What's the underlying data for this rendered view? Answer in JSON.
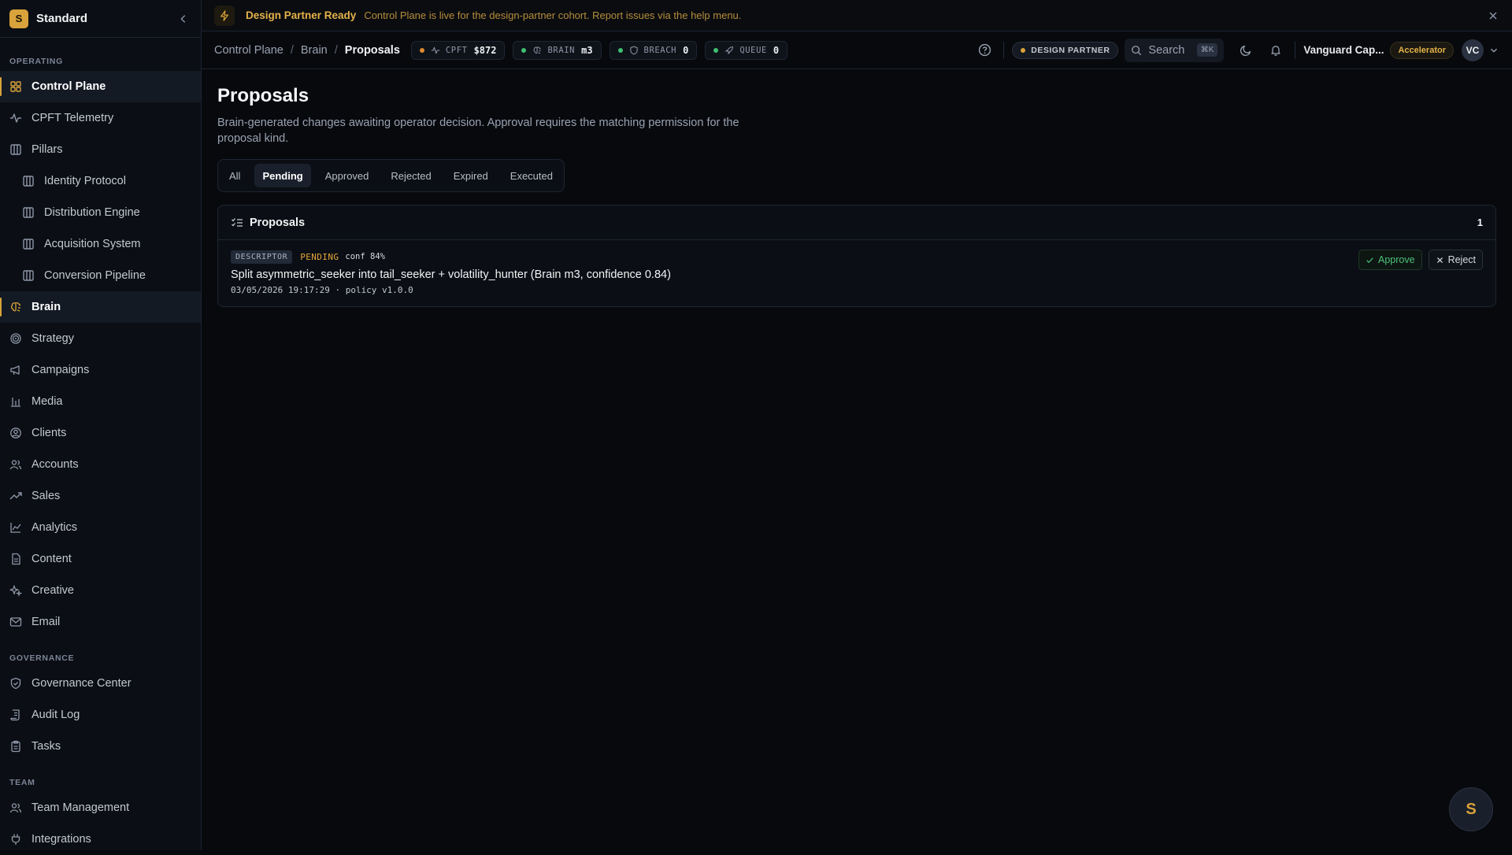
{
  "brand": {
    "logo": "S",
    "name": "Standard"
  },
  "sidebar": {
    "sections": [
      {
        "label": "OPERATING",
        "items": [
          {
            "label": "Control Plane",
            "icon": "grid-icon",
            "active": true
          },
          {
            "label": "CPFT Telemetry",
            "icon": "activity-icon"
          },
          {
            "label": "Pillars",
            "icon": "columns-icon"
          },
          {
            "label": "Identity Protocol",
            "icon": "columns-icon",
            "sub": true
          },
          {
            "label": "Distribution Engine",
            "icon": "columns-icon",
            "sub": true
          },
          {
            "label": "Acquisition System",
            "icon": "columns-icon",
            "sub": true
          },
          {
            "label": "Conversion Pipeline",
            "icon": "columns-icon",
            "sub": true
          },
          {
            "label": "Brain",
            "icon": "brain-icon",
            "active": true
          },
          {
            "label": "Strategy",
            "icon": "target-icon"
          },
          {
            "label": "Campaigns",
            "icon": "megaphone-icon"
          },
          {
            "label": "Media",
            "icon": "bar-chart-icon"
          },
          {
            "label": "Clients",
            "icon": "user-circle-icon"
          },
          {
            "label": "Accounts",
            "icon": "users-icon"
          },
          {
            "label": "Sales",
            "icon": "trending-up-icon"
          },
          {
            "label": "Analytics",
            "icon": "line-chart-icon"
          },
          {
            "label": "Content",
            "icon": "file-text-icon"
          },
          {
            "label": "Creative",
            "icon": "sparkles-icon"
          },
          {
            "label": "Email",
            "icon": "mail-icon"
          }
        ]
      },
      {
        "label": "GOVERNANCE",
        "items": [
          {
            "label": "Governance Center",
            "icon": "shield-check-icon"
          },
          {
            "label": "Audit Log",
            "icon": "scroll-icon"
          },
          {
            "label": "Tasks",
            "icon": "clipboard-icon"
          }
        ]
      },
      {
        "label": "TEAM",
        "items": [
          {
            "label": "Team Management",
            "icon": "users-icon"
          },
          {
            "label": "Integrations",
            "icon": "plug-icon"
          }
        ]
      }
    ]
  },
  "banner": {
    "title": "Design Partner Ready",
    "message": "Control Plane is live for the design-partner cohort. Report issues via the help menu."
  },
  "breadcrumbs": [
    "Control Plane",
    "Brain",
    "Proposals"
  ],
  "status_pills": [
    {
      "label": "CPFT",
      "value": "$872",
      "dot": "#e0892f",
      "icon": "activity-icon"
    },
    {
      "label": "BRAIN",
      "value": "m3",
      "dot": "#3fbf6f",
      "icon": "brain-icon"
    },
    {
      "label": "BREACH",
      "value": "0",
      "dot": "#3fbf6f",
      "icon": "shield-icon"
    },
    {
      "label": "QUEUE",
      "value": "0",
      "dot": "#3fbf6f",
      "icon": "rocket-icon"
    }
  ],
  "header": {
    "partner_badge": "DESIGN PARTNER",
    "search_label": "Search",
    "search_kbd": "⌘K",
    "account_name": "Vanguard Cap...",
    "tier": "Accelerator",
    "avatar": "VC"
  },
  "page": {
    "title": "Proposals",
    "description": "Brain-generated changes awaiting operator decision. Approval requires the matching permission for the proposal kind."
  },
  "tabs": [
    {
      "label": "All"
    },
    {
      "label": "Pending",
      "active": true
    },
    {
      "label": "Approved"
    },
    {
      "label": "Rejected"
    },
    {
      "label": "Expired"
    },
    {
      "label": "Executed"
    }
  ],
  "proposals_card": {
    "title": "Proposals",
    "count": "1",
    "items": [
      {
        "kind": "DESCRIPTOR",
        "status": "PENDING",
        "confidence": "conf 84%",
        "title": "Split asymmetric_seeker into tail_seeker + volatility_hunter (Brain m3, confidence 0.84)",
        "meta": "03/05/2026 19:17:29 · policy v1.0.0",
        "approve_label": "Approve",
        "reject_label": "Reject"
      }
    ]
  },
  "fab": {
    "label": "S"
  }
}
